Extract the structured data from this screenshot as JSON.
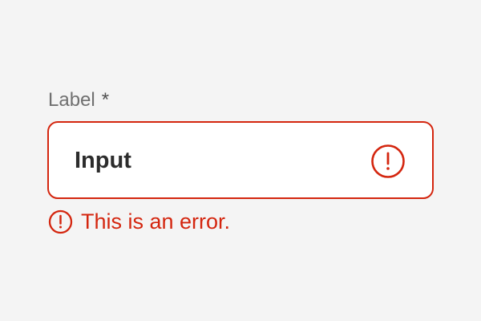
{
  "field": {
    "label": "Label",
    "required_marker": "*",
    "value": "Input",
    "error_message": "This is an error.",
    "state": "error",
    "input_icon": "error-circle-icon",
    "message_icon": "error-circle-icon"
  },
  "colors": {
    "background": "#f4f4f4",
    "error": "#d4260f",
    "label": "#707070",
    "input_text": "#2c2c2c",
    "input_background": "#ffffff"
  }
}
